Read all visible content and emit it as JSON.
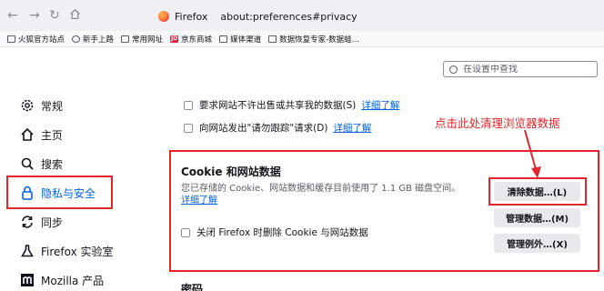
{
  "browser": {
    "brand": "Firefox",
    "url": "about:preferences#privacy"
  },
  "bookmarks": [
    {
      "label": "火狐官方站点",
      "icon": "folder-icon"
    },
    {
      "label": "新手上路",
      "icon": "gear-icon"
    },
    {
      "label": "常用网址",
      "icon": "folder-icon"
    },
    {
      "label": "京东商城",
      "icon": "jd-icon"
    },
    {
      "label": "媒体渠道",
      "icon": "folder-icon"
    },
    {
      "label": "数据恢复专家-数据蛙...",
      "icon": "page-icon"
    }
  ],
  "search": {
    "placeholder": "在设置中查找"
  },
  "sidebar": [
    {
      "label": "常规",
      "icon": "gear-icon",
      "active": false
    },
    {
      "label": "主页",
      "icon": "home-icon",
      "active": false
    },
    {
      "label": "搜索",
      "icon": "search-icon",
      "active": false
    },
    {
      "label": "隐私与安全",
      "icon": "lock-icon",
      "active": true
    },
    {
      "label": "同步",
      "icon": "sync-icon",
      "active": false
    },
    {
      "label": "Firefox 实验室",
      "icon": "flask-icon",
      "active": false
    },
    {
      "label": "Mozilla 产品",
      "icon": "mozilla-icon",
      "active": false
    }
  ],
  "privacy": {
    "opt1": "要求网站不许出售或共享我的数据(S)",
    "opt2": "向网站发出\"请勿跟踪\"请求(D)",
    "learn_more": "详细了解"
  },
  "cookies": {
    "title": "Cookie 和网站数据",
    "desc": "您已存储的 Cookie、网站数据和缓存目前使用了 1.1 GB 磁盘空间。",
    "learn_more": "详细了解",
    "delete_on_close": "关闭 Firefox 时删除 Cookie 与网站数据",
    "btn_clear": "清除数据…(L)",
    "btn_manage": "管理数据…(M)",
    "btn_exceptions": "管理例外…(X)"
  },
  "annotation": "点击此处清理浏览器数据",
  "passwords_title": "密码",
  "colors": {
    "accent": "#0061e0",
    "annotation": "#e0262b"
  }
}
